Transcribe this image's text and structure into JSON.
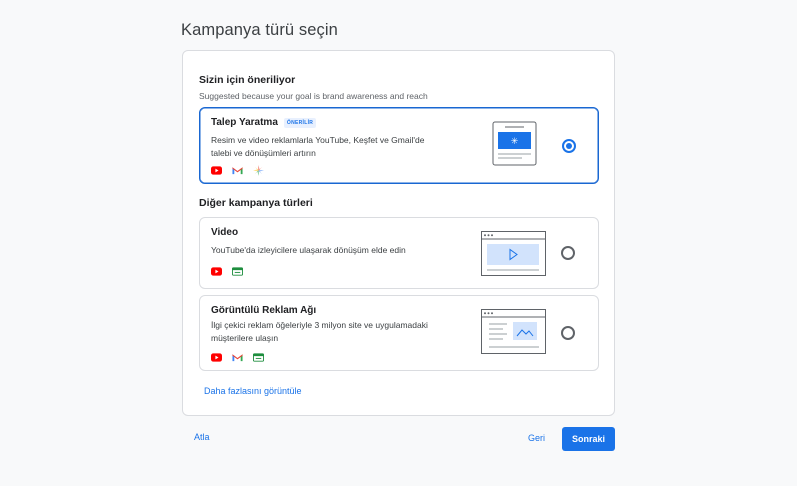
{
  "page": {
    "title": "Kampanya türü seçin"
  },
  "suggested": {
    "title": "Sizin için öneriliyor",
    "subtitle": "Suggested because your goal is brand awareness and reach"
  },
  "options": [
    {
      "title": "Talep Yaratma",
      "badge": "ÖNERİLİR",
      "desc_line1": "Resim ve video reklamlarla YouTube, Keşfet ve Gmail'de",
      "desc_line2": "talebi ve dönüşümleri artırın",
      "selected": true,
      "icons": [
        "youtube-icon",
        "gmail-icon",
        "discover-icon"
      ]
    },
    {
      "title": "Video",
      "desc_line1": "YouTube'da izleyicilere ulaşarak dönüşüm elde edin",
      "selected": false,
      "icons": [
        "youtube-icon",
        "display-network-icon"
      ]
    },
    {
      "title": "Görüntülü Reklam Ağı",
      "desc_line1": "İlgi çekici reklam öğeleriyle 3 milyon site ve uygulamadaki",
      "desc_line2": "müşterilere ulaşın",
      "selected": false,
      "icons": [
        "youtube-icon",
        "gmail-icon",
        "display-network-icon"
      ]
    }
  ],
  "other": {
    "title": "Diğer kampanya türleri"
  },
  "more_link": "Daha fazlasını görüntüle",
  "footer": {
    "skip": "Atla",
    "back": "Geri",
    "next": "Sonraki"
  },
  "colors": {
    "accent": "#1a73e8",
    "youtube": "#ff0000",
    "display": "#1e8e3e"
  }
}
